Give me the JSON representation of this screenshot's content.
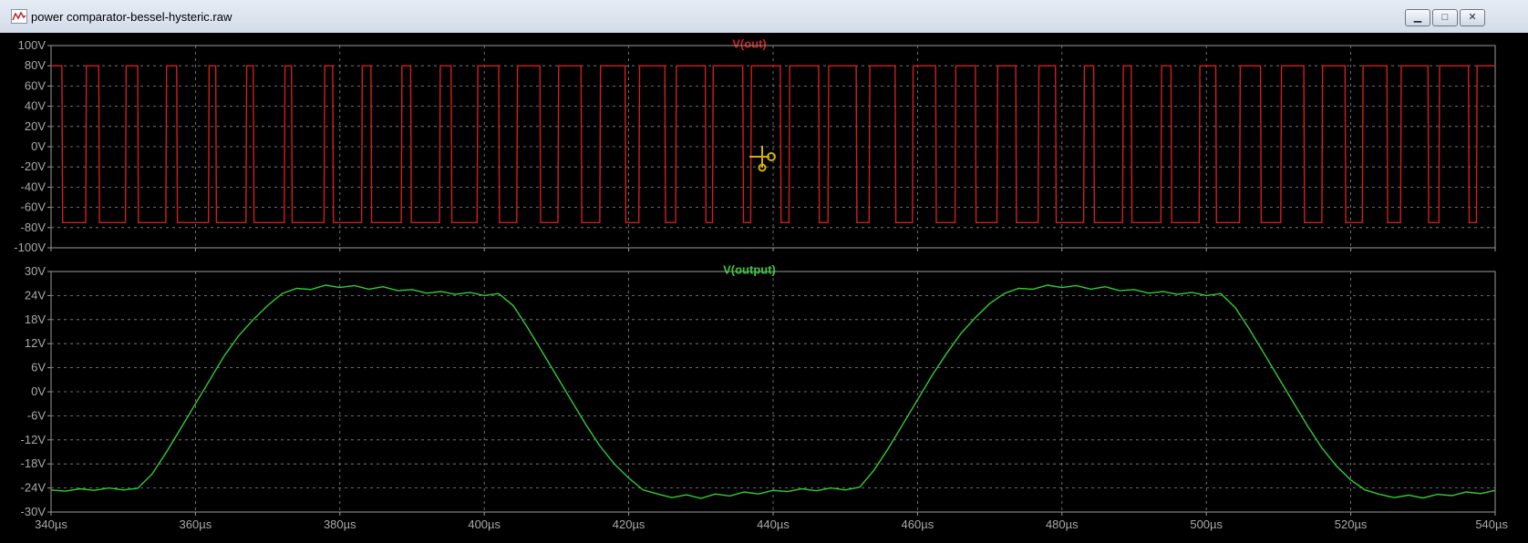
{
  "window": {
    "title": "power comparator-bessel-hysteric.raw",
    "buttons": {
      "minimize": "▁",
      "maximize": "□",
      "close": "✕"
    }
  },
  "colors": {
    "background": "#000000",
    "grid": "#9a9a9a",
    "axis_text": "#a9a9a9",
    "out_trace": "#d11f1f",
    "output_trace": "#33cc33"
  },
  "chart_data": [
    {
      "type": "line",
      "title": "V(out)",
      "x_tick_labels": [
        "340µs",
        "360µs",
        "380µs",
        "400µs",
        "420µs",
        "440µs",
        "460µs",
        "480µs",
        "500µs",
        "520µs",
        "540µs"
      ],
      "y_tick_labels": [
        "100V",
        "80V",
        "60V",
        "40V",
        "20V",
        "0V",
        "-20V",
        "-40V",
        "-60V",
        "-80V",
        "-100V"
      ],
      "xlim": [
        340,
        540
      ],
      "ylim": [
        -100,
        100
      ],
      "grid": true,
      "description_note": "",
      "series": [
        {
          "name": "V(out)",
          "x": [
            340,
            341.5,
            341.6,
            344.8,
            344.9,
            346.6,
            346.7,
            350.3,
            350.4,
            352.0,
            352.1,
            355.9,
            356.0,
            357.4,
            357.5,
            361.8,
            361.9,
            362.8,
            362.9,
            367.0,
            367.1,
            368.0,
            368.1,
            372.3,
            372.4,
            373.3,
            373.4,
            377.8,
            377.9,
            379.0,
            379.1,
            383.0,
            383.1,
            384.3,
            384.4,
            388.5,
            388.6,
            389.8,
            389.9,
            393.8,
            393.9,
            395.4,
            395.5,
            399.0,
            399.1,
            402.0,
            402.1,
            404.5,
            404.6,
            407.7,
            407.8,
            410.2,
            410.3,
            413.4,
            413.5,
            416.0,
            416.1,
            419.5,
            419.6,
            421.4,
            421.5,
            425.0,
            425.1,
            426.5,
            426.6,
            430.6,
            430.7,
            431.6,
            431.7,
            435.8,
            435.9,
            436.9,
            437.0,
            441.0,
            441.1,
            442.2,
            442.3,
            446.3,
            446.4,
            447.6,
            447.7,
            451.5,
            451.6,
            453.3,
            453.4,
            456.9,
            457.0,
            459.3,
            459.4,
            462.5,
            462.6,
            465.2,
            465.3,
            468.0,
            468.1,
            471.0,
            471.1,
            473.6,
            473.7,
            476.7,
            476.8,
            479.1,
            479.2,
            483.0,
            483.1,
            484.4,
            484.5,
            488.4,
            488.5,
            489.6,
            489.7,
            493.7,
            493.8,
            495.1,
            495.2,
            499.0,
            499.1,
            501.3,
            501.4,
            504.6,
            504.7,
            507.5,
            507.6,
            510.3,
            510.4,
            513.5,
            513.6,
            516.0,
            516.1,
            519.2,
            519.3,
            521.6,
            521.7,
            525.0,
            525.1,
            526.9,
            527.0,
            530.7,
            530.8,
            532.2,
            532.3,
            536.3,
            536.4,
            537.4,
            537.5,
            540
          ],
          "values": [
            80,
            80,
            -75,
            -75,
            80,
            80,
            -75,
            -75,
            80,
            80,
            -75,
            -75,
            80,
            80,
            -75,
            -75,
            80,
            80,
            -75,
            -75,
            80,
            80,
            -75,
            -75,
            80,
            80,
            -75,
            -75,
            80,
            80,
            -75,
            -75,
            80,
            80,
            -75,
            -75,
            80,
            80,
            -75,
            -75,
            80,
            80,
            -75,
            -75,
            80,
            80,
            -75,
            -75,
            80,
            80,
            -75,
            -75,
            80,
            80,
            -75,
            -75,
            80,
            80,
            -75,
            -75,
            80,
            80,
            -75,
            -75,
            80,
            80,
            -75,
            -75,
            80,
            80,
            -75,
            -75,
            80,
            80,
            -75,
            -75,
            80,
            80,
            -75,
            -75,
            80,
            80,
            -75,
            -75,
            80,
            80,
            -75,
            -75,
            80,
            80,
            -75,
            -75,
            80,
            80,
            -75,
            -75,
            80,
            80,
            -75,
            -75,
            80,
            80,
            -75,
            -75,
            80,
            80,
            -75,
            -75,
            80,
            80,
            -75,
            -75,
            80,
            80,
            -75,
            -75,
            80,
            80,
            -75,
            -75,
            80,
            80,
            -75,
            -75,
            80,
            80,
            -75,
            -75,
            80,
            80,
            -75,
            -75,
            80,
            80,
            -75,
            -75,
            80,
            80,
            -75,
            -75,
            80,
            80,
            -75,
            -75,
            80,
            80
          ]
        }
      ]
    },
    {
      "type": "line",
      "title": "V(output)",
      "x_tick_labels": [
        "340µs",
        "360µs",
        "380µs",
        "400µs",
        "420µs",
        "440µs",
        "460µs",
        "480µs",
        "500µs",
        "520µs",
        "540µs"
      ],
      "y_tick_labels": [
        "30V",
        "24V",
        "18V",
        "12V",
        "6V",
        "0V",
        "-6V",
        "-12V",
        "-18V",
        "-24V",
        "-30V"
      ],
      "xlim": [
        340,
        540
      ],
      "ylim": [
        -30,
        30
      ],
      "grid": true,
      "series": [
        {
          "name": "V(output)",
          "x": [
            340,
            342,
            344,
            346,
            348,
            350,
            352,
            354,
            356,
            358,
            360,
            362,
            364,
            366,
            368,
            370,
            372,
            374,
            376,
            378,
            380,
            382,
            384,
            386,
            388,
            390,
            392,
            394,
            396,
            398,
            400,
            402,
            404,
            406,
            408,
            410,
            412,
            414,
            416,
            418,
            420,
            422,
            424,
            426,
            428,
            430,
            432,
            434,
            436,
            438,
            440,
            442,
            444,
            446,
            448,
            450,
            452,
            454,
            456,
            458,
            460,
            462,
            464,
            466,
            468,
            470,
            472,
            474,
            476,
            478,
            480,
            482,
            484,
            486,
            488,
            490,
            492,
            494,
            496,
            498,
            500,
            502,
            504,
            506,
            508,
            510,
            512,
            514,
            516,
            518,
            520,
            522,
            524,
            526,
            528,
            530,
            532,
            534,
            536,
            538,
            540
          ],
          "values": [
            -24.5,
            -24.8,
            -24.2,
            -24.6,
            -24.0,
            -24.5,
            -24.1,
            -20.5,
            -15.0,
            -9.0,
            -3.0,
            3.0,
            9.0,
            14.0,
            18.0,
            21.5,
            24.5,
            25.8,
            25.5,
            26.6,
            26.0,
            26.5,
            25.6,
            26.2,
            25.2,
            25.5,
            24.6,
            25.0,
            24.3,
            24.8,
            24.0,
            24.5,
            21.5,
            16.0,
            10.0,
            4.0,
            -2.0,
            -8.0,
            -13.5,
            -18.0,
            -21.5,
            -24.5,
            -25.5,
            -26.4,
            -25.7,
            -26.6,
            -25.5,
            -26.0,
            -25.0,
            -25.5,
            -24.6,
            -24.9,
            -24.2,
            -24.7,
            -24.0,
            -24.5,
            -23.8,
            -19.5,
            -14.0,
            -8.0,
            -2.0,
            4.0,
            9.5,
            14.5,
            18.5,
            22.0,
            24.5,
            25.8,
            25.6,
            26.6,
            26.0,
            26.5,
            25.6,
            26.2,
            25.2,
            25.5,
            24.6,
            25.0,
            24.3,
            24.8,
            24.0,
            24.5,
            21.0,
            15.5,
            9.5,
            3.5,
            -2.5,
            -8.5,
            -14.0,
            -18.5,
            -22.0,
            -24.5,
            -25.6,
            -26.4,
            -25.8,
            -26.5,
            -25.6,
            -25.9,
            -25.0,
            -25.4,
            -24.6
          ]
        }
      ]
    }
  ]
}
